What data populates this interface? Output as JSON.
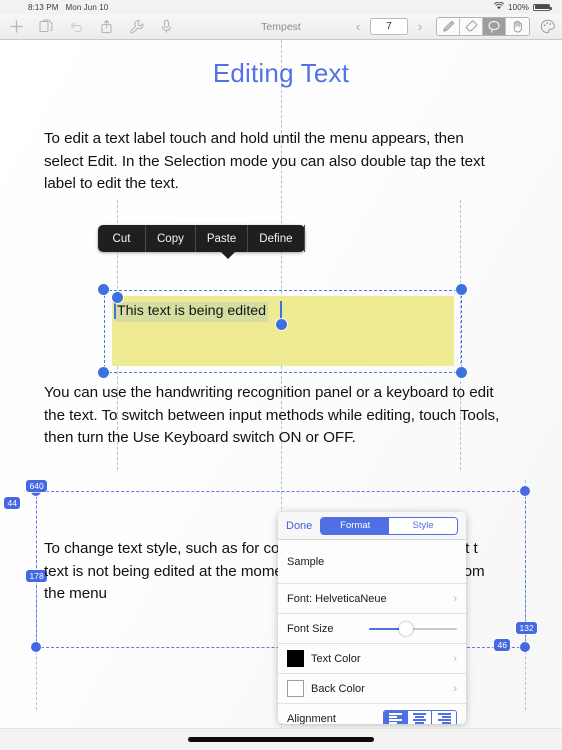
{
  "status_bar": {
    "time": "8:13 PM",
    "date": "Mon Jun 10",
    "wifi_icon": "wifi-icon",
    "battery_percent": "100%",
    "battery_icon": "battery-icon"
  },
  "toolbar": {
    "title": "Tempest",
    "left_icons": [
      {
        "name": "add-icon",
        "label": "+"
      },
      {
        "name": "duplicate-page-icon",
        "label": ""
      },
      {
        "name": "undo-icon",
        "label": ""
      },
      {
        "name": "share-icon",
        "label": ""
      },
      {
        "name": "tools-wrench-icon",
        "label": ""
      },
      {
        "name": "microphone-icon",
        "label": ""
      }
    ],
    "prev_page_label": "‹",
    "page_number": "7",
    "next_page_label": "›",
    "tool_segments": [
      {
        "name": "pen-tool",
        "active": false
      },
      {
        "name": "eraser-tool",
        "active": false
      },
      {
        "name": "lasso-tool",
        "active": true
      },
      {
        "name": "hand-tool",
        "active": false
      }
    ],
    "palette_icon": "palette-icon"
  },
  "document": {
    "title": "Editing Text",
    "title_color": "#5471e8",
    "paragraphs": [
      "To edit a text label touch and hold until the menu appears, then select Edit. In the Selection mode you can also double tap the text label to edit the text.",
      "You can use the handwriting recognition panel or a keyboard to edit the text. To switch between input methods while editing, touch Tools, then turn the Use Keyboard switch ON or OFF.",
      "To change text style, such as for colors, touch Tools, then select t                              text is not being edited at the moment,                      bel, then select Styles from the menu"
    ],
    "edited_label": {
      "text": "This text is being edited",
      "box_color": "#efeb92",
      "highlight_color": "#d5dda0"
    }
  },
  "context_menu": {
    "items": [
      {
        "label": "Cut",
        "name": "context-menu-cut"
      },
      {
        "label": "Copy",
        "name": "context-menu-copy"
      },
      {
        "label": "Paste",
        "name": "context-menu-paste"
      },
      {
        "label": "Define",
        "name": "context-menu-define"
      }
    ]
  },
  "measurement_badges": [
    {
      "value": "640",
      "name": "measure-badge-640"
    },
    {
      "value": "44",
      "name": "measure-badge-44"
    },
    {
      "value": "178",
      "name": "measure-badge-178"
    },
    {
      "value": "132",
      "name": "measure-badge-132"
    },
    {
      "value": "46",
      "name": "measure-badge-46"
    }
  ],
  "popover": {
    "done_label": "Done",
    "tabs": [
      {
        "label": "Format",
        "active": true
      },
      {
        "label": "Style",
        "active": false
      }
    ],
    "sample_label": "Sample",
    "font_row_label": "Font: HelveticaNeue",
    "font_size_label": "Font Size",
    "font_size_value": 40,
    "text_color_label": "Text Color",
    "text_color_value": "#000000",
    "back_color_label": "Back Color",
    "back_color_value": "#ffffff",
    "alignment_label": "Alignment",
    "alignment_options": [
      {
        "name": "align-left",
        "active": true
      },
      {
        "name": "align-center",
        "active": false
      },
      {
        "name": "align-right",
        "active": false
      }
    ],
    "chevron": "›",
    "accent_color": "#4f6fe2"
  }
}
